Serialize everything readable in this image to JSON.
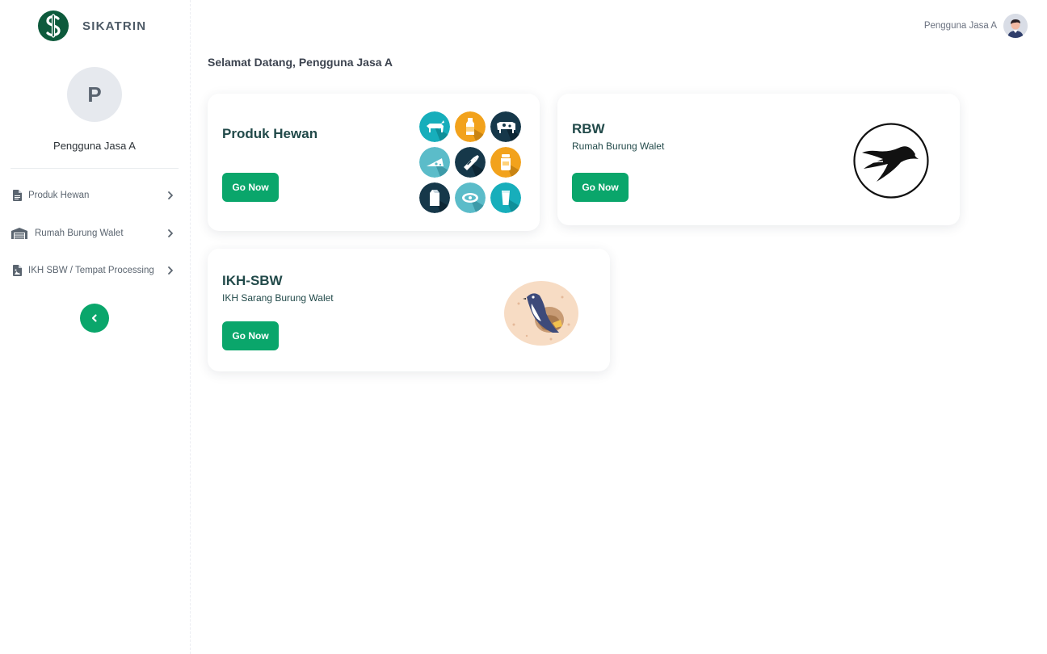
{
  "app": {
    "brand": "SIKATRIN"
  },
  "sidebar": {
    "avatar_letter": "P",
    "user_name": "Pengguna Jasa A",
    "items": [
      {
        "label": "Produk Hewan",
        "icon": "document-icon"
      },
      {
        "label": "Rumah Burung Walet",
        "icon": "warehouse-icon"
      },
      {
        "label": "IKH SBW / Tempat Processing",
        "icon": "image-file-icon"
      }
    ]
  },
  "header": {
    "user_name": "Pengguna Jasa A"
  },
  "main": {
    "welcome": "Selamat Datang, Pengguna Jasa A",
    "cards": [
      {
        "title": "Produk Hewan",
        "subtitle": "",
        "button": "Go Now"
      },
      {
        "title": "RBW",
        "subtitle": "Rumah Burung Walet",
        "button": "Go Now"
      },
      {
        "title": "IKH-SBW",
        "subtitle": "IKH Sarang Burung Walet",
        "button": "Go Now"
      }
    ]
  },
  "colors": {
    "accent": "#0aa66b",
    "title": "#224a4a",
    "teal": "#17aebb",
    "navy": "#16384a",
    "orange": "#f2a21c"
  }
}
